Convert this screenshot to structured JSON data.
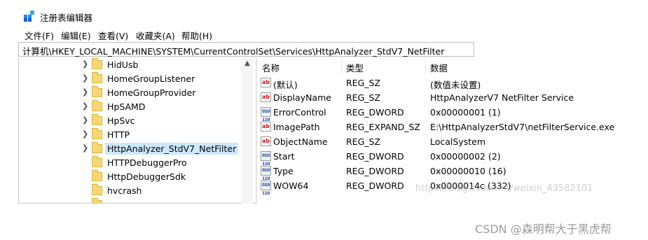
{
  "window": {
    "title": "注册表编辑器"
  },
  "menu": [
    "文件(F)",
    "编辑(E)",
    "查看(V)",
    "收藏夹(A)",
    "帮助(H)"
  ],
  "address_bar": {
    "path": "计算机\\HKEY_LOCAL_MACHINE\\SYSTEM\\CurrentControlSet\\Services\\HttpAnalyzer_StdV7_NetFilter"
  },
  "tree": {
    "items": [
      {
        "label": "HidUsb",
        "expandable": true
      },
      {
        "label": "HomeGroupListener",
        "expandable": true
      },
      {
        "label": "HomeGroupProvider",
        "expandable": true
      },
      {
        "label": "HpSAMD",
        "expandable": true
      },
      {
        "label": "HpSvc",
        "expandable": true
      },
      {
        "label": "HTTP",
        "expandable": true
      },
      {
        "label": "HttpAnalyzer_StdV7_NetFilter",
        "expandable": true,
        "selected": true
      },
      {
        "label": "HTTPDebuggerPro",
        "expandable": false
      },
      {
        "label": "HttpDebuggerSdk",
        "expandable": false
      },
      {
        "label": "hvcrash",
        "expandable": false
      }
    ]
  },
  "list": {
    "columns": [
      "名称",
      "类型",
      "数据"
    ],
    "rows": [
      {
        "icon": "string-value-icon",
        "name": "(默认)",
        "type": "REG_SZ",
        "data": "(数值未设置)"
      },
      {
        "icon": "string-value-icon",
        "name": "DisplayName",
        "type": "REG_SZ",
        "data": "HttpAnalyzerV7 NetFilter Service"
      },
      {
        "icon": "binary-value-icon",
        "name": "ErrorControl",
        "type": "REG_DWORD",
        "data": "0x00000001 (1)"
      },
      {
        "icon": "string-value-icon",
        "name": "ImagePath",
        "type": "REG_EXPAND_SZ",
        "data": "E:\\HttpAnalyzerStdV7\\netFilterService.exe"
      },
      {
        "icon": "string-value-icon",
        "name": "ObjectName",
        "type": "REG_SZ",
        "data": "LocalSystem"
      },
      {
        "icon": "binary-value-icon",
        "name": "Start",
        "type": "REG_DWORD",
        "data": "0x00000002 (2)"
      },
      {
        "icon": "binary-value-icon",
        "name": "Type",
        "type": "REG_DWORD",
        "data": "0x00000010 (16)"
      },
      {
        "icon": "binary-value-icon",
        "name": "WOW64",
        "type": "REG_DWORD",
        "data": "0x0000014c (332)"
      }
    ]
  },
  "overlay": {
    "watermark": "https://blog.csdn.net/weixin_43582101",
    "credit": "CSDN @森明帮大于黑虎帮"
  },
  "colors": {
    "selection": "#cce8ff",
    "folder": "#f6d776",
    "sz_icon": "#c41818",
    "dword_icon": "#1a3f9a"
  }
}
